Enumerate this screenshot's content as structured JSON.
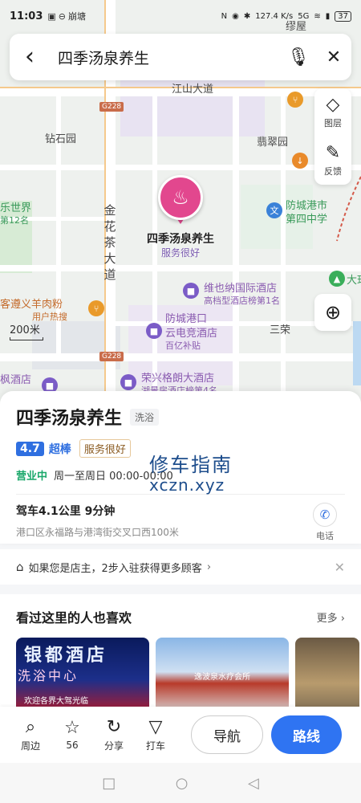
{
  "status_bar": {
    "time": "11:03",
    "network_speed": "127.4 K/s",
    "signal": "5G",
    "battery": "37"
  },
  "search": {
    "query": "四季汤泉养生"
  },
  "map_controls": {
    "layers_label": "图层",
    "feedback_label": "反馈"
  },
  "map": {
    "scale": "200米",
    "labels": {
      "jiangshan": "江山大道",
      "zuanshi": "钻石园",
      "feicui": "翡翠园",
      "leshijie": "乐世界",
      "leshijie_sub": "第12名",
      "fangcheng_school": "防城港市",
      "fangcheng_school2": "第四中学",
      "jinhuacha": "金花茶大道",
      "weiyena": "维也纳国际酒店",
      "weiyena_sub": "高档型酒店榜第1名",
      "kezun": "客遵义羊肉粉",
      "kezun_sub": "用户热搜",
      "fangchenggang_kou": "防城港口",
      "yundian": "云电竞酒店",
      "baiyi": "百亿补贴",
      "sanrong": "三荣",
      "rongxing": "荣兴格朗大酒店",
      "rongxing_sub": "湖景房酒店榜第4名",
      "feng": "枫酒店",
      "dama": "大珏",
      "fengxiang": "缪屋",
      "tangtang": "崩塘",
      "g228a": "G228",
      "g228b": "G228"
    }
  },
  "marker": {
    "name": "四季汤泉养生",
    "tag": "服务很好"
  },
  "place": {
    "name": "四季汤泉养生",
    "category": "洗浴",
    "score": "4.7",
    "score_label": "超棒",
    "service_badge": "服务很好",
    "open_status": "营业中",
    "hours": "周一至周日 00:00-00:00",
    "drive": "驾车4.1公里 9分钟",
    "address": "港口区永福路与港湾街交叉口西100米",
    "phone_label": "电话"
  },
  "watermark": {
    "line1": "修车指南",
    "line2": "xczn.xyz"
  },
  "owner_banner": {
    "text": "如果您是店主，2步入驻获得更多顾客"
  },
  "recommendations": {
    "title": "看过这里的人也喜欢",
    "more": "更多",
    "card1_title": "银都酒店",
    "card1_sub": "洗浴中心",
    "card1_line": "欢迎各界大驾光临",
    "card2_sign": "逸波泉水疗会所"
  },
  "toolbar": {
    "nearby": "周边",
    "favorites": "56",
    "share": "分享",
    "taxi": "打车",
    "navigate": "导航",
    "route": "路线"
  }
}
